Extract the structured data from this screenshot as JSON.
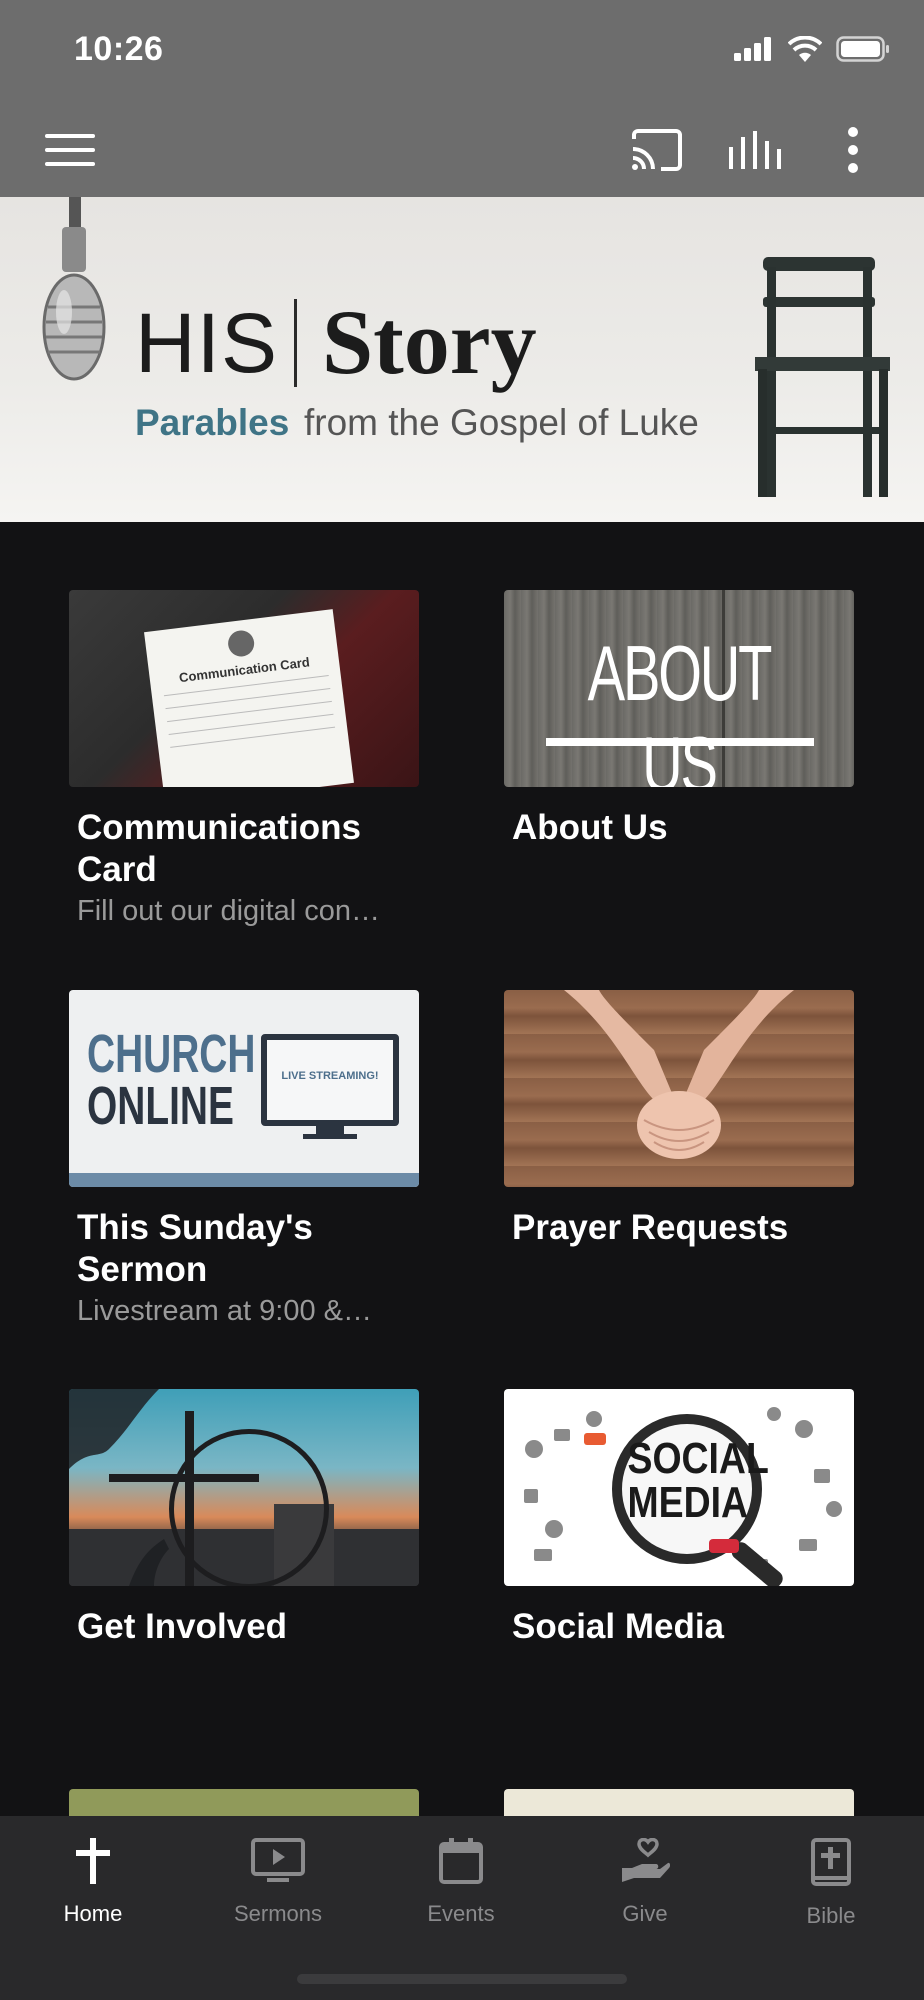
{
  "status_bar": {
    "time": "10:26"
  },
  "toolbar": {
    "menu_icon": "hamburger-icon",
    "cast_icon": "cast-icon",
    "audio_icon": "equalizer-icon",
    "more_icon": "more-vertical-icon"
  },
  "banner": {
    "title_left": "HIS",
    "title_right": "Story",
    "subtitle_highlight": "Parables",
    "subtitle_rest": "from the Gospel of Luke",
    "accent_color": "#3f7486"
  },
  "cards": [
    {
      "title": "Communications Card",
      "subtitle": "Fill out our digital con…",
      "thumb_text": "Communication Card"
    },
    {
      "title": "About Us",
      "subtitle": "",
      "thumb_text": "ABOUT US"
    },
    {
      "title": "This Sunday's Sermon",
      "subtitle": "Livestream at 9:00 &…",
      "thumb_text_a": "CHURCH",
      "thumb_text_b": "ONLINE",
      "thumb_text_c": "LIVE STREAMING!"
    },
    {
      "title": "Prayer Requests",
      "subtitle": ""
    },
    {
      "title": "Get Involved",
      "subtitle": ""
    },
    {
      "title": "Social Media",
      "subtitle": "",
      "thumb_text_a": "SOCIAL",
      "thumb_text_b": "MEDIA"
    }
  ],
  "bottom_nav": [
    {
      "label": "Home",
      "icon": "cross-icon",
      "active": true
    },
    {
      "label": "Sermons",
      "icon": "tv-play-icon",
      "active": false
    },
    {
      "label": "Events",
      "icon": "calendar-icon",
      "active": false
    },
    {
      "label": "Give",
      "icon": "hand-heart-icon",
      "active": false
    },
    {
      "label": "Bible",
      "icon": "bible-icon",
      "active": false
    }
  ]
}
